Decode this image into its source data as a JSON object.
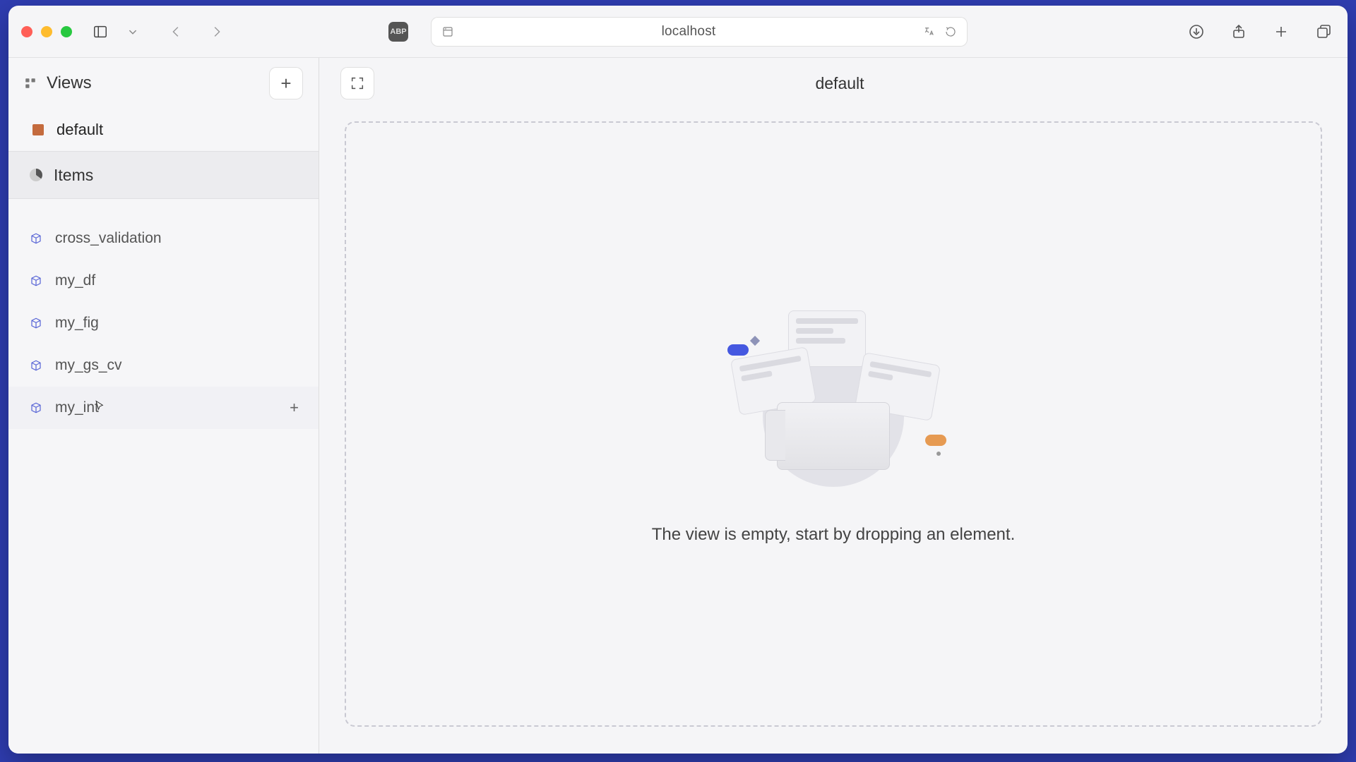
{
  "browser": {
    "url_label": "localhost",
    "abp_label": "ABP"
  },
  "sidebar": {
    "views_label": "Views",
    "views": [
      {
        "label": "default"
      }
    ],
    "items_label": "Items",
    "items": [
      {
        "label": "cross_validation"
      },
      {
        "label": "my_df"
      },
      {
        "label": "my_fig"
      },
      {
        "label": "my_gs_cv"
      },
      {
        "label": "my_int"
      }
    ]
  },
  "main": {
    "title": "default",
    "empty_hint": "The view is empty, start by dropping an element."
  }
}
